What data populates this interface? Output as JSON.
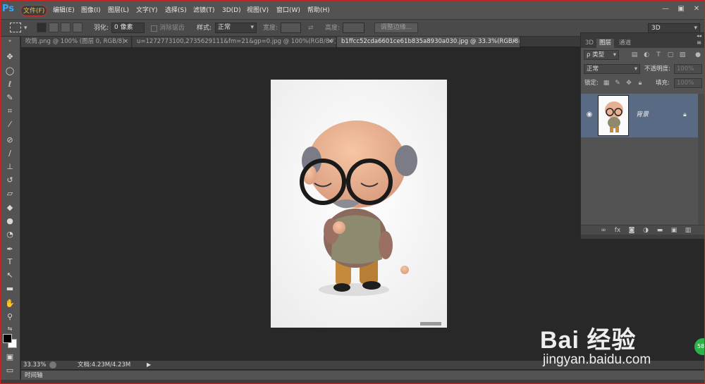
{
  "app": {
    "logo": "Ps"
  },
  "menu": [
    "文件(F)",
    "编辑(E)",
    "图像(I)",
    "图层(L)",
    "文字(Y)",
    "选择(S)",
    "滤镜(T)",
    "3D(D)",
    "视图(V)",
    "窗口(W)",
    "帮助(H)"
  ],
  "window_controls": {
    "minimize": "—",
    "restore": "▣",
    "close": "✕"
  },
  "options": {
    "feather_label": "羽化:",
    "feather_value": "0 像素",
    "antialias_label": "消除锯齿",
    "style_label": "样式:",
    "style_value": "正常",
    "width_label": "宽度:",
    "height_label": "高度:",
    "swap_icon": "⇄",
    "refine_button": "调整边缘..."
  },
  "workspace": {
    "value": "3D"
  },
  "tabs": [
    {
      "label": "吹筒.png @ 100% (图层 0, RGB/8)"
    },
    {
      "label": "u=1272773100,2735629111&fm=21&gp=0.jpg @ 100%(RGB/8#)"
    },
    {
      "label": "b1ffcc52cda6601ce61b835a8930a030.jpg @ 33.3%(RGB/8#)"
    }
  ],
  "tab_close": "×",
  "tools": [
    "move-tool",
    "marquee-tool",
    "lasso-tool",
    "quick-selection-tool",
    "crop-tool",
    "eyedropper-tool",
    "healing-brush-tool",
    "brush-tool",
    "clone-stamp-tool",
    "history-brush-tool",
    "eraser-tool",
    "paint-bucket-tool",
    "blur-tool",
    "dodge-tool",
    "pen-tool",
    "type-tool",
    "path-selection-tool",
    "rectangle-tool",
    "hand-tool",
    "zoom-tool"
  ],
  "status": {
    "zoom": "33.33%",
    "doc": "文档:4.23M/4.23M",
    "arrow": "▶"
  },
  "timeline": {
    "label": "时间轴"
  },
  "layers_panel": {
    "collapse": "◂◂",
    "tabs": [
      "3D",
      "图层",
      "通道"
    ],
    "filter_label": "ρ 类型",
    "blend_mode": "正常",
    "opacity_label": "不透明度:",
    "opacity_value": "100%",
    "lock_label": "锁定:",
    "fill_label": "填充:",
    "fill_value": "100%",
    "layer_name": "背景"
  },
  "watermark": {
    "logo": "Bai 经验",
    "url": "jingyan.baidu.com",
    "badge": "58"
  },
  "colors": {
    "accent": "#31a8ff",
    "selected_layer": "#596b84",
    "highlight": "#e8c64a",
    "annotation": "#d03030"
  }
}
